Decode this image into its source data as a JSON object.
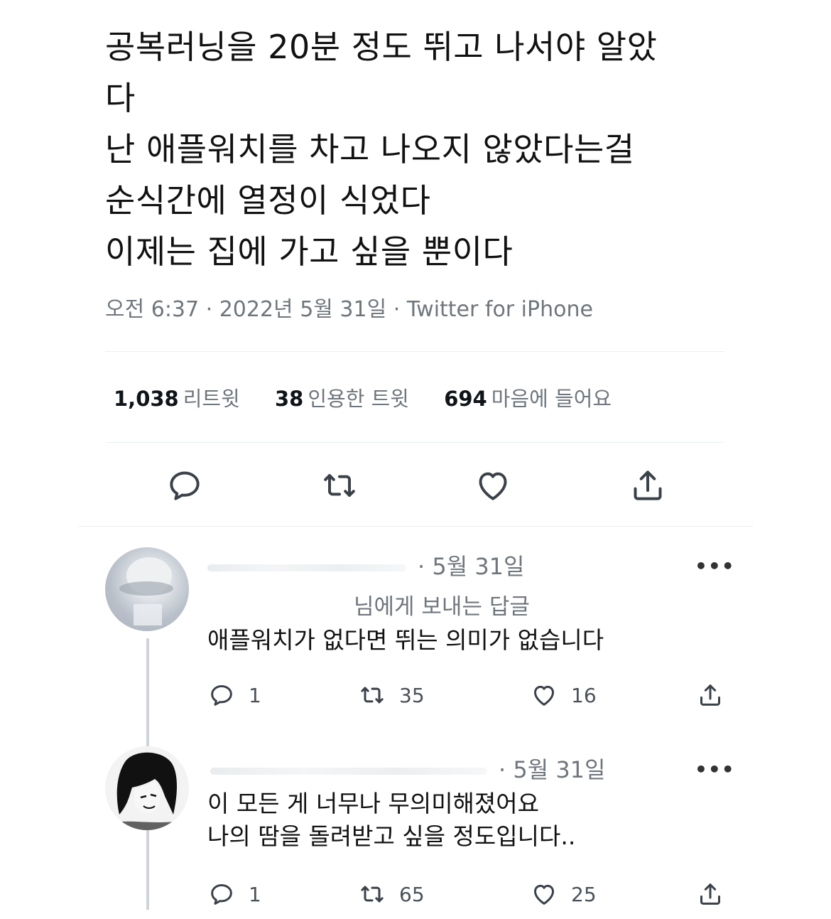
{
  "tweet": {
    "lines": [
      "공복러닝을 20분 정도 뛰고 나서야 알았",
      "다",
      "난 애플워치를 차고 나오지 않았다는걸",
      "순식간에 열정이 식었다",
      "이제는 집에 가고 싶을 뿐이다"
    ],
    "meta": "오전 6:37 · 2022년 5월 31일 · Twitter for iPhone"
  },
  "stats": {
    "retweets_count": "1,038",
    "retweets_label": "리트윗",
    "quotes_count": "38",
    "quotes_label": "인용한 트윗",
    "likes_count": "694",
    "likes_label": "마음에 들어요"
  },
  "actions": {
    "icons": [
      "reply-icon",
      "retweet-icon",
      "like-icon",
      "share-icon"
    ]
  },
  "replies": [
    {
      "date": "· 5월 31일",
      "replying_to": "님에게 보내는 답글",
      "text": [
        "애플워치가 없다면 뛰는 의미가 없습니다"
      ],
      "reply_count": "1",
      "retweet_count": "35",
      "like_count": "16",
      "more": "•••"
    },
    {
      "date": "· 5월 31일",
      "text": [
        "이 모든 게 너무나 무의미해졌어요",
        "나의 땀을 돌려받고 싶을 정도입니다.."
      ],
      "reply_count": "1",
      "retweet_count": "65",
      "like_count": "25",
      "more": "•••"
    }
  ],
  "colors": {
    "text": "#0f1419",
    "secondary": "#6f767c",
    "divider": "#eceef0",
    "thread_line": "#d0d4d8"
  }
}
